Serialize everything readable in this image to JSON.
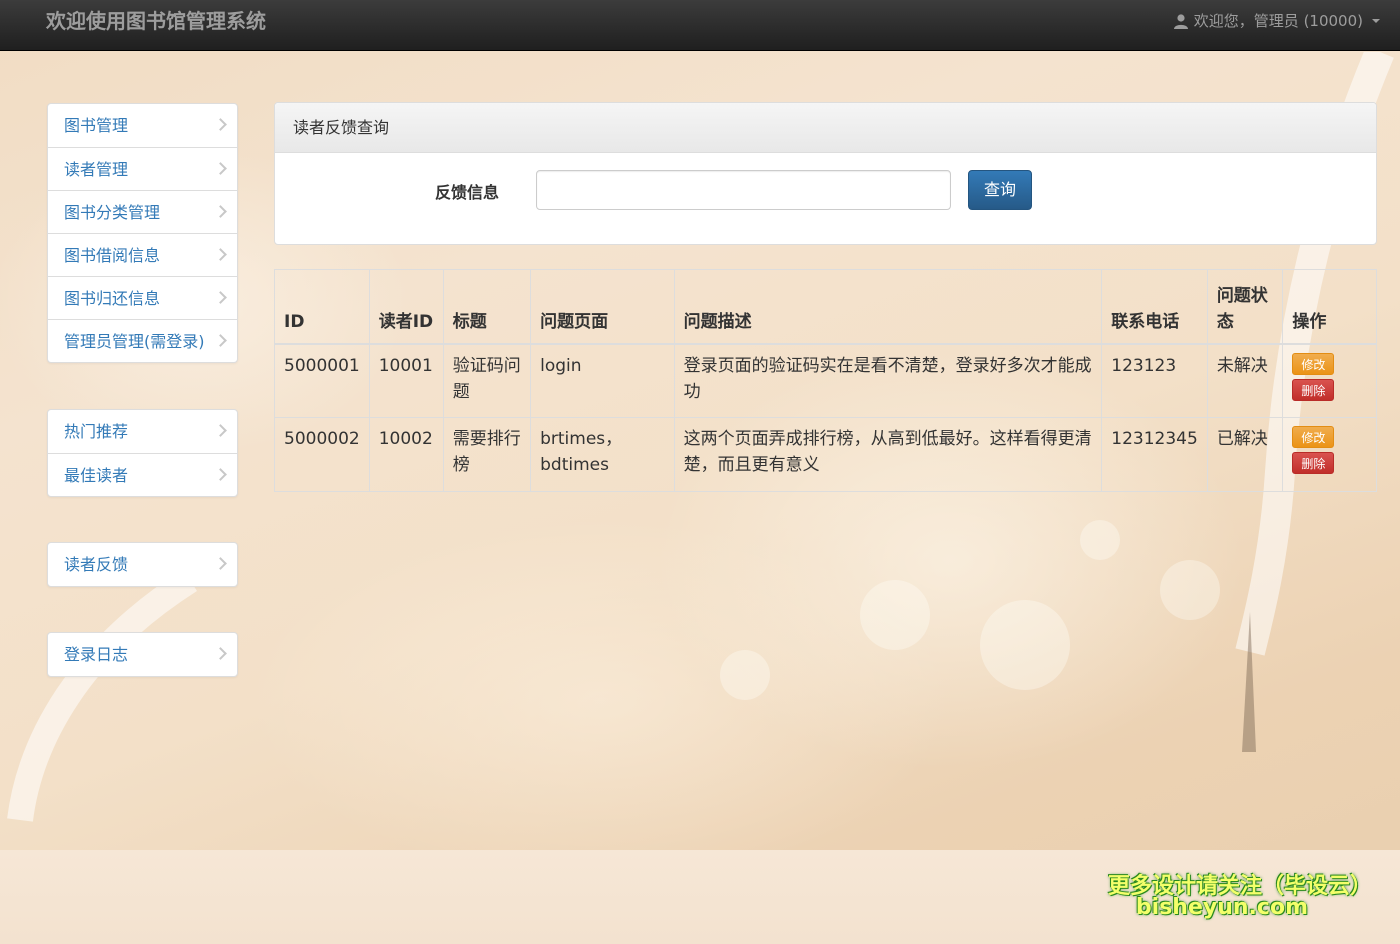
{
  "navbar": {
    "brand": "欢迎使用图书馆管理系统",
    "user_label": "欢迎您，管理员 (10000)"
  },
  "sidebar": {
    "groups": [
      {
        "items": [
          {
            "label": "图书管理"
          },
          {
            "label": "读者管理"
          },
          {
            "label": "图书分类管理"
          },
          {
            "label": "图书借阅信息"
          },
          {
            "label": "图书归还信息"
          },
          {
            "label": "管理员管理(需登录)"
          }
        ]
      },
      {
        "items": [
          {
            "label": "热门推荐"
          },
          {
            "label": "最佳读者"
          }
        ]
      },
      {
        "items": [
          {
            "label": "读者反馈"
          }
        ]
      },
      {
        "items": [
          {
            "label": "登录日志"
          }
        ]
      }
    ]
  },
  "query_panel": {
    "title": "读者反馈查询",
    "field_label": "反馈信息",
    "field_value": "",
    "button_label": "查询"
  },
  "table": {
    "headers": [
      "ID",
      "读者ID",
      "标题",
      "问题页面",
      "问题描述",
      "联系电话",
      "问题状态",
      "操作"
    ],
    "rows": [
      {
        "id": "5000001",
        "reader_id": "10001",
        "title": "验证码问题",
        "page": "login",
        "description": "登录页面的验证码实在是看不清楚，登录好多次才能成功",
        "phone": "123123",
        "status": "未解决",
        "edit_label": "修改",
        "delete_label": "删除"
      },
      {
        "id": "5000002",
        "reader_id": "10002",
        "title": "需要排行榜",
        "page": "brtimes，bdtimes",
        "description": "这两个页面弄成排行榜，从高到低最好。这样看得更清楚，而且更有意义",
        "phone": "12312345",
        "status": "已解决",
        "edit_label": "修改",
        "delete_label": "删除"
      }
    ]
  },
  "watermark": {
    "line1": "更多设计请关注（毕设云）",
    "line2": "bisheyun.com"
  }
}
